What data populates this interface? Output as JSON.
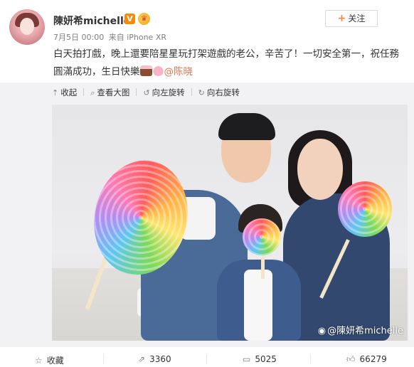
{
  "post": {
    "username": "陳妍希michelle",
    "verified_badge": "V",
    "vip_badge_icon": "crown-icon",
    "timestamp": "7月5日 00:00",
    "source": "来自 iPhone XR",
    "follow_label": "关注",
    "follow_plus": "+",
    "text_part1": "白天拍打戲，晚上還要陪星星玩打架遊戲的老公，辛苦了！一切安全第一，祝任務圓滿成功，生日快樂",
    "mention": "@陈晓"
  },
  "media_tools": {
    "collapse": "收起",
    "view_large": "查看大图",
    "rotate_left": "向左旋转",
    "rotate_right": "向右旋转"
  },
  "photo": {
    "watermark": "@陳妍希michelle"
  },
  "actions": {
    "favorite": "收藏",
    "repost": "3360",
    "comment": "5025",
    "like": "66279"
  },
  "colors": {
    "accent": "#ff8140",
    "mention": "#eb7350",
    "verified": "#f78a07",
    "media_bg": "#f2f2f5"
  }
}
